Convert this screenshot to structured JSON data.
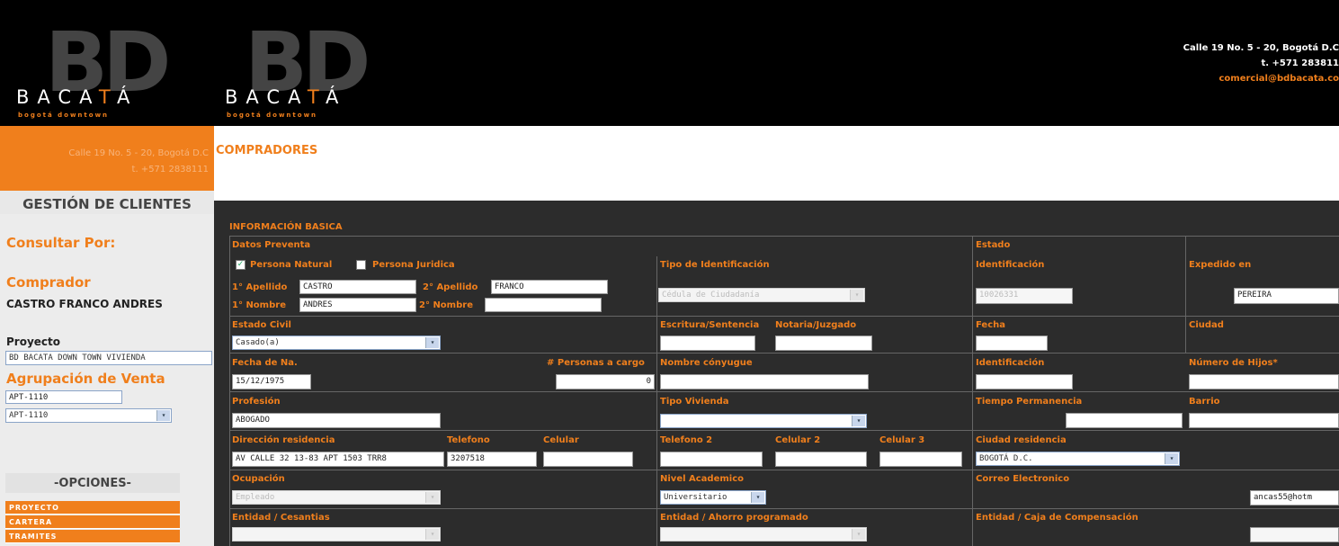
{
  "header": {
    "logo1": {
      "bd": "BD",
      "name_a": "BACA",
      "name_t": "T",
      "name_b": "Á",
      "sub": "bogotá downtown"
    },
    "logo2": {
      "bd": "BD",
      "name_a": "BACA",
      "name_t": "T",
      "name_b": "Á",
      "sub": "bogotá downtown"
    },
    "address": "Calle 19 No. 5 - 20, Bogotá D.C",
    "phone": "t. +571 283811",
    "email": "comercial@bdbacata.co"
  },
  "sidebar": {
    "ghost_address": "Calle 19 No. 5 - 20, Bogotá D.C",
    "ghost_phone": "t. +571 2838111",
    "title": "GESTIÓN DE CLIENTES",
    "consultar": "Consultar Por:",
    "comprador_label": "Comprador",
    "comprador_value": "CASTRO FRANCO ANDRES",
    "proyecto_label": "Proyecto",
    "proyecto_value": "BD BACATA DOWN TOWN VIVIENDA",
    "agrupacion_label": "Agrupación de Venta",
    "agrupacion_input": "APT-1110",
    "agrupacion_select": "APT-1110",
    "opciones_title": "-OPCIONES-",
    "opciones": [
      "PROYECTO",
      "CARTERA",
      "TRAMITES"
    ]
  },
  "page": {
    "title": "COMPRADORES",
    "section": "INFORMACIÓN BASICA"
  },
  "form": {
    "datos_preventa": "Datos Preventa",
    "estado": "Estado",
    "persona_natural": "Persona Natural",
    "persona_juridica": "Persona Juridica",
    "tipo_id": "Tipo de Identificación",
    "identificacion": "Identificación",
    "expedido": "Expedido en",
    "ap1_label": "1° Apellido",
    "ap1": "CASTRO",
    "ap2_label": "2° Apellido",
    "ap2": "FRANCO",
    "nom1_label": "1° Nombre",
    "nom1": "ANDRES",
    "nom2_label": "2° Nombre",
    "nom2": "",
    "tipo_id_value": "Cédula de Ciudadanía",
    "id_value": "10026331",
    "expedido_value": "PEREIRA",
    "estado_civil": "Estado Civil",
    "estado_civil_value": "Casado(a)",
    "escritura": "Escritura/Sentencia",
    "notaria": "Notaria/Juzgado",
    "fecha": "Fecha",
    "ciudad": "Ciudad",
    "fecha_nac": "Fecha de Na.",
    "fecha_nac_value": "15/12/1975",
    "personas_cargo": "# Personas a cargo",
    "personas_cargo_value": "0",
    "nombre_conyugue": "Nombre cónyugue",
    "identificacion2": "Identificación",
    "num_hijos": "Número de Hijos*",
    "profesion": "Profesión",
    "profesion_value": "ABOGADO",
    "tipo_vivienda": "Tipo Vivienda",
    "tiempo_perm": "Tiempo Permanencia",
    "barrio": "Barrio",
    "direccion": "Dirección residencia",
    "direccion_value": "AV CALLE 32 13-83 APT 1503 TRR8",
    "telefono": "Telefono",
    "telefono_value": "3207518",
    "celular": "Celular",
    "telefono2": "Telefono 2",
    "celular2": "Celular 2",
    "celular3": "Celular 3",
    "ciudad_res": "Ciudad residencia",
    "ciudad_res_value": "BOGOTÁ D.C.",
    "ocupacion": "Ocupación",
    "ocupacion_value": "Empleado",
    "nivel_acad": "Nivel Academico",
    "nivel_acad_value": "Universitario",
    "correo": "Correo Electronico",
    "correo_value": "ancas55@hotm",
    "entidad_ces": "Entidad / Cesantias",
    "entidad_ahorro": "Entidad / Ahorro programado",
    "entidad_caja": "Entidad / Caja de Compensación",
    "sel_arrow": "▾",
    "check_mark": "✓"
  },
  "colors": {
    "accent": "#f07f1c",
    "header_bg": "#000000",
    "form_bg": "#2c2c2c"
  }
}
